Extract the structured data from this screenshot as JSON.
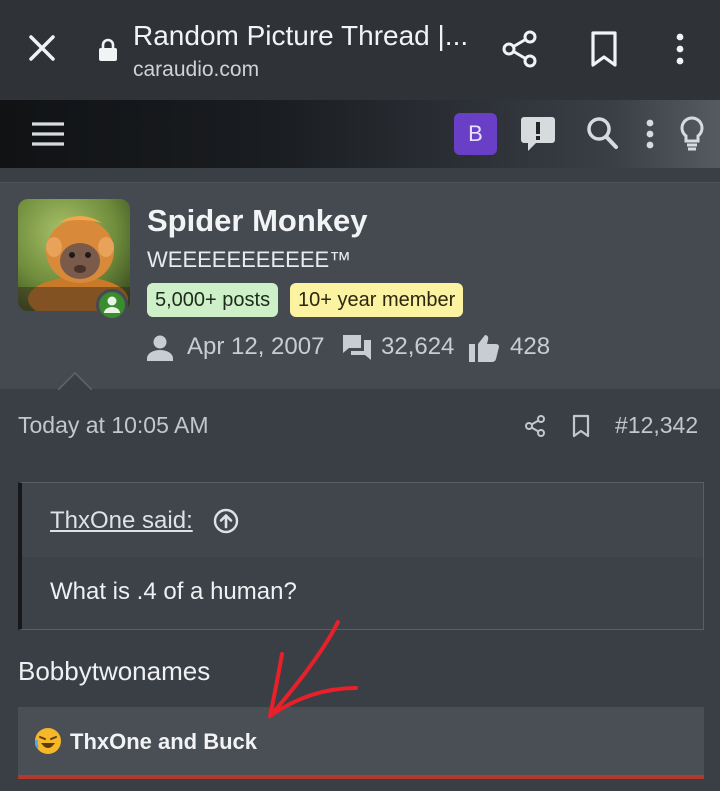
{
  "browser": {
    "page_title": "Random Picture Thread |...",
    "url": "caraudio.com"
  },
  "forum_nav": {
    "badge_letter": "B"
  },
  "user": {
    "name": "Spider Monkey",
    "title": "WEEEEEEEEEEE™",
    "badges": [
      "5,000+ posts",
      "10+ year member"
    ],
    "joined": "Apr 12, 2007",
    "messages": "32,624",
    "reaction_score": "428",
    "online": true
  },
  "post": {
    "date": "Today at 10:05 AM",
    "number": "#12,342",
    "quote": {
      "author": "ThxOne said:",
      "text": "What is .4 of a human?"
    },
    "body": "Bobbytwonames",
    "reactions": "ThxOne and Buck"
  },
  "colors": {
    "accent_badge": "#6a3fc7",
    "online": "#3b8b2f",
    "badge_posts": "#cdf0c8",
    "badge_member": "#fbf3a2",
    "reaction_underline": "#b33a2a",
    "annotation_arrow": "#e8202a"
  }
}
